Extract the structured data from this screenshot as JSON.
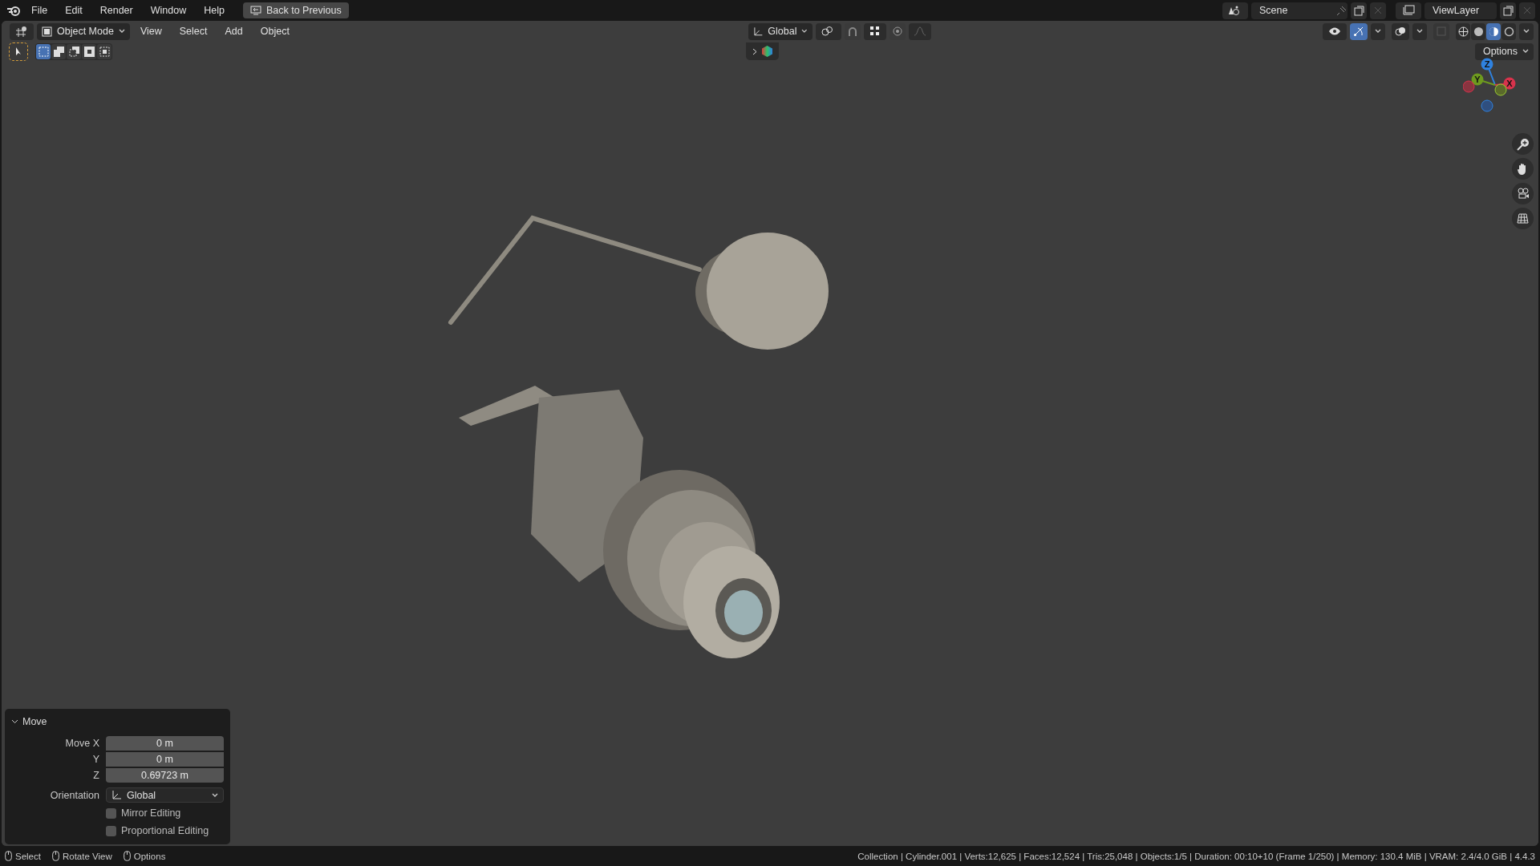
{
  "top_bar": {
    "menus": [
      "File",
      "Edit",
      "Render",
      "Window",
      "Help"
    ],
    "back_button": "Back to Previous",
    "scene": "Scene",
    "view_layer": "ViewLayer"
  },
  "viewport_header": {
    "mode": "Object Mode",
    "menus": [
      "View",
      "Select",
      "Add",
      "Object"
    ],
    "orientation": "Global",
    "gizmos_on": true,
    "shading_modes": [
      {
        "kind": "wireframe",
        "selected": false
      },
      {
        "kind": "solid",
        "selected": false
      },
      {
        "kind": "material",
        "selected": true
      },
      {
        "kind": "rendered",
        "selected": false
      }
    ]
  },
  "toolbar": {
    "select_modes": [
      {
        "kind": "new",
        "selected": true
      },
      {
        "kind": "extend",
        "selected": false
      },
      {
        "kind": "subtract",
        "selected": false
      },
      {
        "kind": "invert",
        "selected": false
      },
      {
        "kind": "intersect",
        "selected": false
      }
    ],
    "options": "Options"
  },
  "gizmo": {
    "axes": [
      {
        "label": "Z",
        "color": "#2f82e0"
      },
      {
        "label": "Y",
        "color": "#6e9a1e"
      },
      {
        "label": "X",
        "color": "#d8334c"
      }
    ]
  },
  "operator_panel": {
    "title": "Move",
    "expanded": true,
    "fields": [
      {
        "label": "Move X",
        "value": "0 m"
      },
      {
        "label": "Y",
        "value": "0 m"
      },
      {
        "label": "Z",
        "value": "0.69723 m"
      }
    ],
    "orientation": {
      "label": "Orientation",
      "value": "Global"
    },
    "checkboxes": [
      {
        "label": "Mirror Editing",
        "checked": false
      },
      {
        "label": "Proportional Editing",
        "checked": false
      }
    ]
  },
  "status_bar": {
    "hints": [
      "Select",
      "Rotate View",
      "Options"
    ],
    "info": "Collection | Cylinder.001 | Verts:12,625 | Faces:12,524 | Tris:25,048 | Objects:1/5 | Duration: 00:10+10 (Frame 1/250) | Memory: 130.4 MiB | VRAM: 2.4/4.0 GiB | 4.4.3"
  }
}
